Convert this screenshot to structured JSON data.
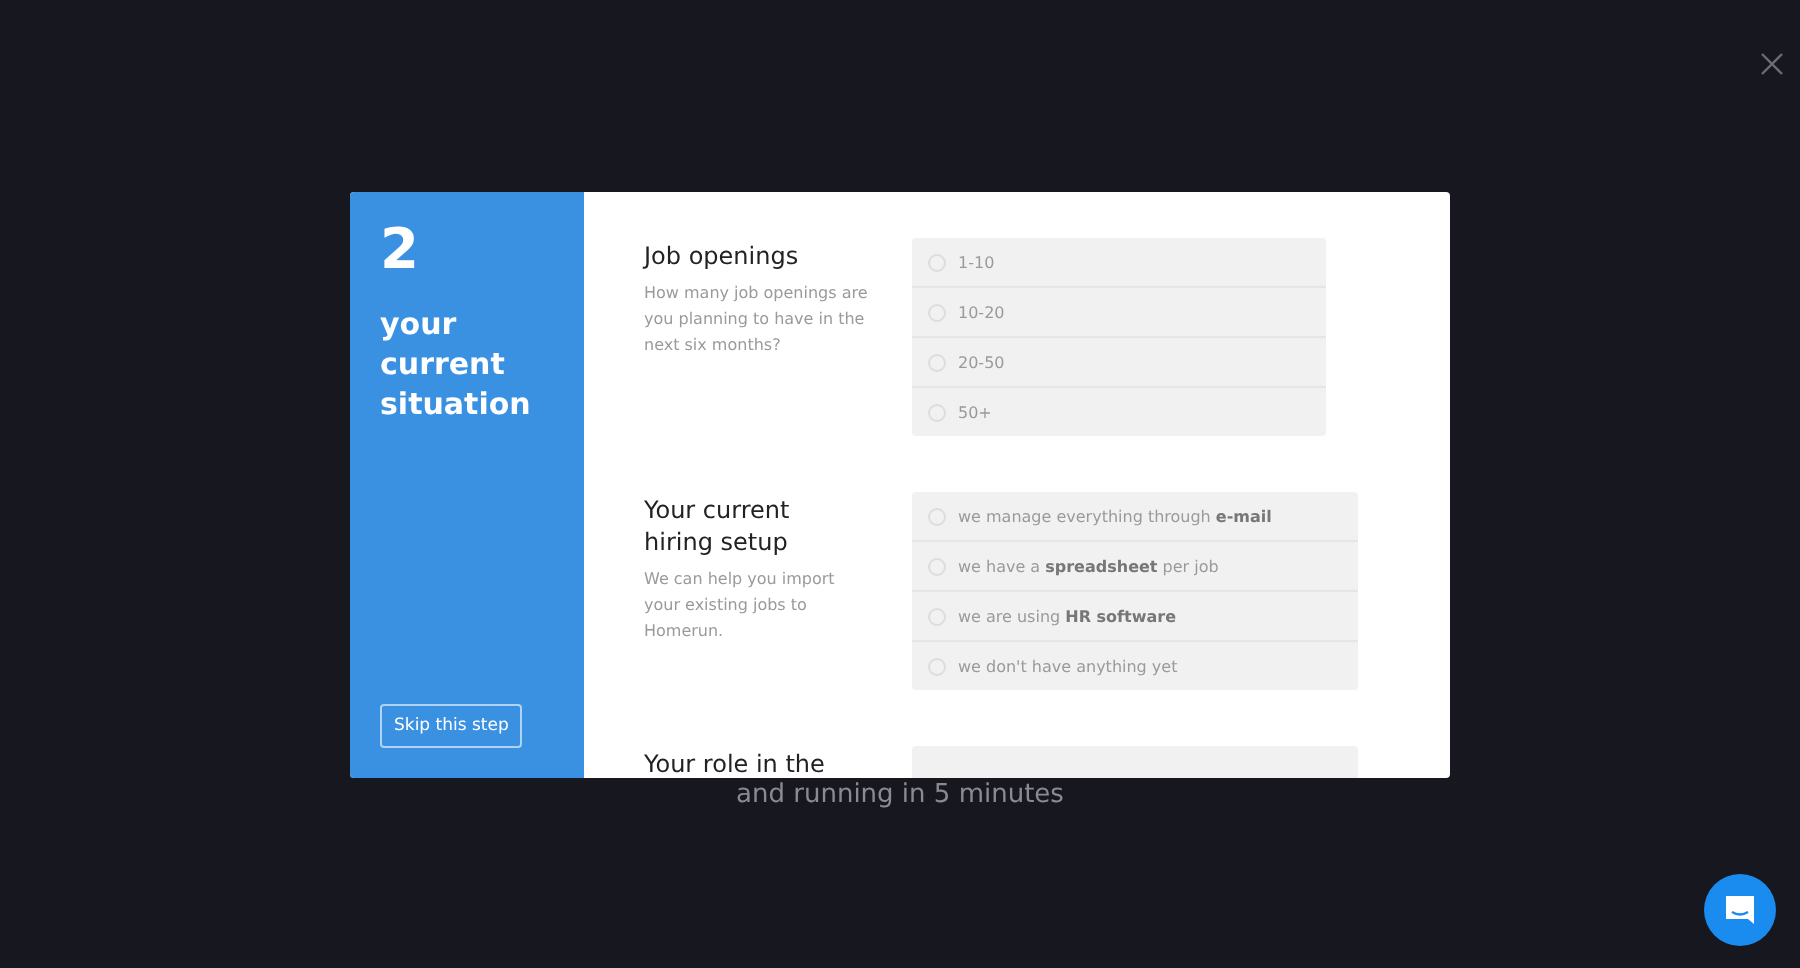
{
  "backdrop_text": "and running in 5 minutes",
  "modal": {
    "step_number": "2",
    "step_title": "your current situation",
    "skip_button": "Skip this step",
    "sections": [
      {
        "title": "Job openings",
        "description": "How many job openings are you planning to have in the next six months?",
        "options": [
          {
            "label": "1-10",
            "selected": false
          },
          {
            "label": "10-20",
            "selected": false
          },
          {
            "label": "20-50",
            "selected": false
          },
          {
            "label": "50+",
            "selected": false
          }
        ]
      },
      {
        "title": "Your current hiring setup",
        "description": "We can help you import your existing jobs to Homerun.",
        "options": [
          {
            "label": "we manage everything through **e-mail**",
            "selected": false
          },
          {
            "label": "we have a **spreadsheet** per job",
            "selected": false
          },
          {
            "label": "we are using **HR software**",
            "selected": false
          },
          {
            "label": "we don't have anything yet",
            "selected": false
          }
        ]
      },
      {
        "title": "Your role in the"
      }
    ]
  }
}
